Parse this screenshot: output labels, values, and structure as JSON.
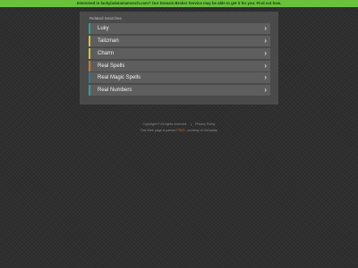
{
  "banner": {
    "text": "Interested in luckyladatamamosch.com? Our Domain Broker Service may be able to get it for you. Find out how.",
    "color": "#6ac13a"
  },
  "panel": {
    "title": "Related Searches",
    "items": [
      {
        "label": "Luky",
        "accent": "#2aa39b",
        "icon": "chevron-right-icon"
      },
      {
        "label": "Talizman",
        "accent": "#d8c23a",
        "icon": "chevron-right-icon"
      },
      {
        "label": "Charm",
        "accent": "#d8c23a",
        "icon": "chevron-right-icon"
      },
      {
        "label": "Real Spells",
        "accent": "#d8791e",
        "icon": "chevron-right-icon"
      },
      {
        "label": "Real Magic Spells",
        "accent": "#2a7fa3",
        "icon": "chevron-right-icon"
      },
      {
        "label": "Real Numbers",
        "accent": "#2aa39b",
        "icon": "chevron-right-icon"
      }
    ]
  },
  "footer": {
    "copyright": "Copyright ©  All rights reserved.",
    "privacy": "Privacy Policy",
    "disclaimer_prefix": "This Web page is parked",
    "disclaimer_highlight": "FREE",
    "disclaimer_suffix": ", courtesy of GoDaddy."
  }
}
